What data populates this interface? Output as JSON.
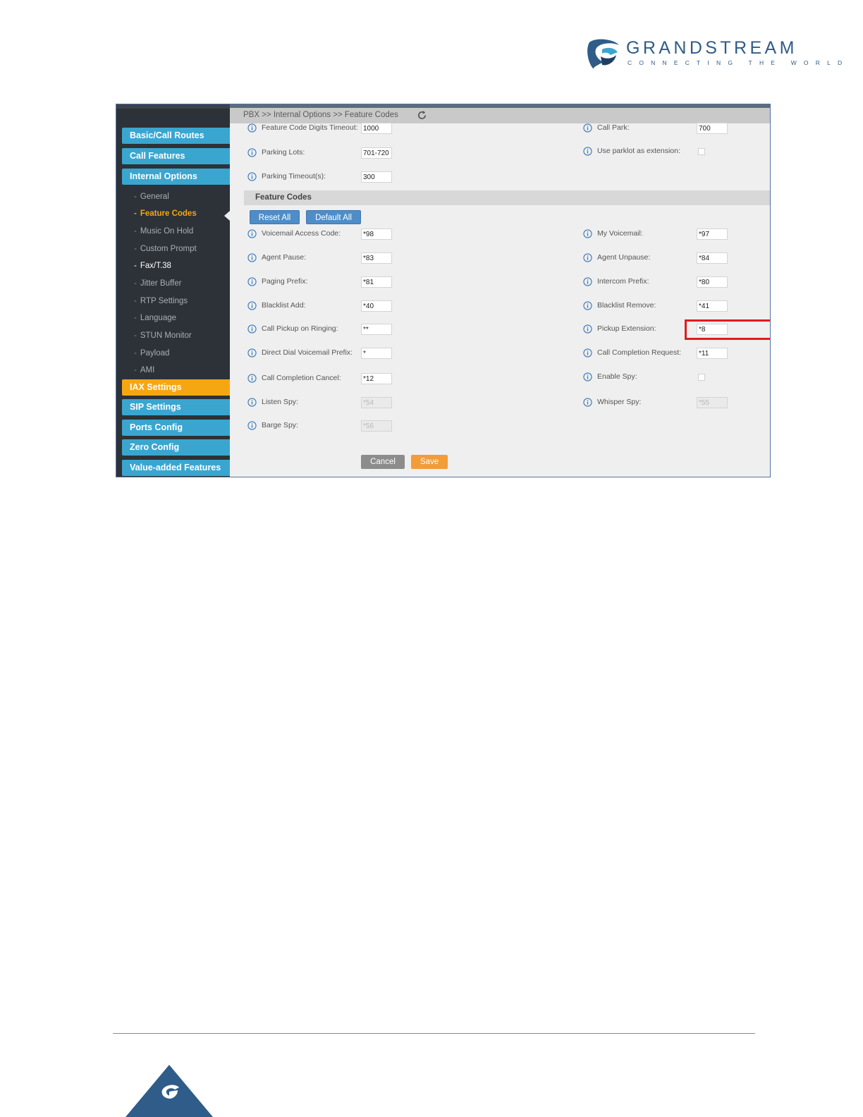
{
  "brand": {
    "name": "GRANDSTREAM",
    "tagline": "CONNECTING THE WORLD",
    "color": "#2f5c89"
  },
  "breadcrumb": "PBX >> Internal Options >> Feature Codes",
  "sidebar": {
    "items": [
      {
        "label": "Basic/Call Routes"
      },
      {
        "label": "Call Features"
      },
      {
        "label": "Internal Options"
      }
    ],
    "subitems": [
      {
        "label": "General"
      },
      {
        "label": "Feature Codes"
      },
      {
        "label": "Music On Hold"
      },
      {
        "label": "Custom Prompt"
      },
      {
        "label": "Fax/T.38"
      },
      {
        "label": "Jitter Buffer"
      },
      {
        "label": "RTP Settings"
      },
      {
        "label": "Language"
      },
      {
        "label": "STUN Monitor"
      },
      {
        "label": "Payload"
      },
      {
        "label": "AMI"
      }
    ],
    "bottom_items": [
      {
        "label": "IAX Settings"
      },
      {
        "label": "SIP Settings"
      },
      {
        "label": "Ports Config"
      },
      {
        "label": "Zero Config"
      },
      {
        "label": "Value-added Features"
      }
    ]
  },
  "general": {
    "digits_timeout": {
      "label": "Feature Code Digits Timeout:",
      "value": "1000"
    },
    "call_park": {
      "label": "Call Park:",
      "value": "700"
    },
    "parking_lots": {
      "label": "Parking Lots:",
      "value": "701-720"
    },
    "use_parklot": {
      "label": "Use parklot as extension:"
    },
    "parking_timeout": {
      "label": "Parking Timeout(s):",
      "value": "300"
    }
  },
  "feature_codes": {
    "title": "Feature Codes",
    "reset_all": "Reset All",
    "default_all": "Default All",
    "voicemail_access": {
      "label": "Voicemail Access Code:",
      "value": "*98"
    },
    "my_voicemail": {
      "label": "My Voicemail:",
      "value": "*97"
    },
    "agent_pause": {
      "label": "Agent Pause:",
      "value": "*83"
    },
    "agent_unpause": {
      "label": "Agent Unpause:",
      "value": "*84"
    },
    "paging_prefix": {
      "label": "Paging Prefix:",
      "value": "*81"
    },
    "intercom_prefix": {
      "label": "Intercom Prefix:",
      "value": "*80"
    },
    "blacklist_add": {
      "label": "Blacklist Add:",
      "value": "*40"
    },
    "blacklist_remove": {
      "label": "Blacklist Remove:",
      "value": "*41"
    },
    "call_pickup_ringing": {
      "label": "Call Pickup on Ringing:",
      "value": "**"
    },
    "pickup_extension": {
      "label": "Pickup Extension:",
      "value": "*8"
    },
    "direct_dial_vm": {
      "label": "Direct Dial Voicemail Prefix:",
      "value": "*"
    },
    "call_completion_request": {
      "label": "Call Completion Request:",
      "value": "*11"
    },
    "call_completion_cancel": {
      "label": "Call Completion Cancel:",
      "value": "*12"
    },
    "enable_spy": {
      "label": "Enable Spy:"
    },
    "listen_spy": {
      "label": "Listen Spy:",
      "value": "*54"
    },
    "whisper_spy": {
      "label": "Whisper Spy:",
      "value": "*55"
    },
    "barge_spy": {
      "label": "Barge Spy:",
      "value": "*56"
    }
  },
  "actions": {
    "cancel": "Cancel",
    "save": "Save"
  },
  "colors": {
    "nav_blue": "#3aa6d0",
    "nav_orange": "#f5a712",
    "highlight": "#e31b1b",
    "save": "#f29c3a"
  }
}
